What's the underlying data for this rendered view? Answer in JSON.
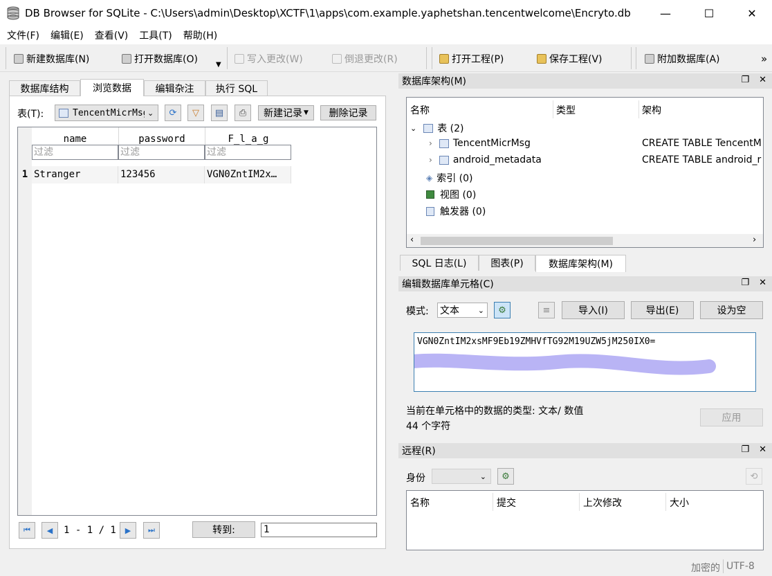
{
  "window": {
    "title": "DB Browser for SQLite - C:\\Users\\admin\\Desktop\\XCTF\\1\\apps\\com.example.yaphetshan.tencentwelcome\\Encryto.db",
    "minimize": "—",
    "maximize": "☐",
    "close": "✕"
  },
  "menu": [
    "文件(F)",
    "编辑(E)",
    "查看(V)",
    "工具(T)",
    "帮助(H)"
  ],
  "toolbar": {
    "new_db": "新建数据库(N)",
    "open_db": "打开数据库(O)",
    "write": "写入更改(W)",
    "revert": "倒退更改(R)",
    "open_project": "打开工程(P)",
    "save_project": "保存工程(V)",
    "attach_db": "附加数据库(A)",
    "more": "»"
  },
  "left_tabs": [
    "数据库结构",
    "浏览数据",
    "编辑杂注",
    "执行 SQL"
  ],
  "browse": {
    "table_label": "表(T):",
    "table_value": "TencentMicrMsg",
    "new_record": "新建记录",
    "delete_record": "删除记录",
    "columns": [
      "name",
      "password",
      "F_l_a_g"
    ],
    "filter_placeholder": "过滤",
    "rows": [
      {
        "num": "1",
        "name": "Stranger",
        "password": "123456",
        "flag": "VGN0ZntIM2x…"
      }
    ],
    "pager": "1 - 1 / 1",
    "goto_label": "转到:",
    "goto_value": "1"
  },
  "schema_panel": {
    "title": "数据库架构(M)",
    "headers": [
      "名称",
      "类型",
      "架构"
    ],
    "tables_label": "表 (2)",
    "items": [
      {
        "name": "TencentMicrMsg",
        "schema": "CREATE TABLE TencentM"
      },
      {
        "name": "android_metadata",
        "schema": "CREATE TABLE android_r"
      }
    ],
    "indexes": "索引 (0)",
    "views": "视图 (0)",
    "triggers": "触发器 (0)"
  },
  "right_tabs": [
    "SQL 日志(L)",
    "图表(P)",
    "数据库架构(M)"
  ],
  "edit_cell": {
    "title": "编辑数据库单元格(C)",
    "mode_label": "模式:",
    "mode_value": "文本",
    "import": "导入(I)",
    "export": "导出(E)",
    "set_null": "设为空",
    "value": "VGN0ZntIM2xsMF9Eb19ZMHVfTG92M19UZW5jM250IX0=",
    "type_info": "当前在单元格中的数据的类型: 文本/ 数值",
    "char_count": "44 个字符",
    "apply": "应用"
  },
  "remote": {
    "title": "远程(R)",
    "identity_label": "身份",
    "headers": [
      "名称",
      "提交",
      "上次修改",
      "大小"
    ]
  },
  "status": {
    "encrypted": "加密的",
    "encoding": "UTF-8"
  },
  "colors": {
    "highlight": "#b9b4f5",
    "dock_header": "#e0e0e0"
  }
}
